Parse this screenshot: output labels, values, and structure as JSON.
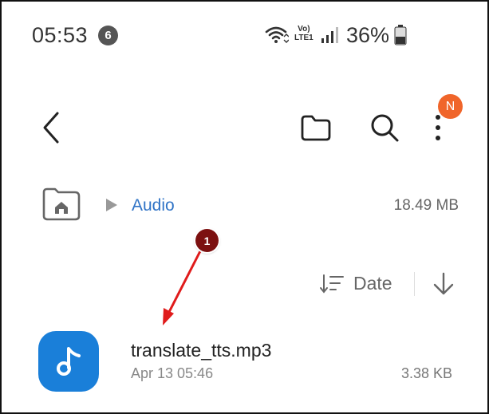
{
  "status_bar": {
    "time": "05:53",
    "notification_count": "6",
    "volte_line1": "Vo)",
    "volte_line2": "LTE1",
    "battery_percent": "36%"
  },
  "toolbar": {
    "back_icon": "chevron-left-icon",
    "folder_icon": "folder-icon",
    "search_icon": "search-icon",
    "more_icon": "more-vertical-icon",
    "avatar_initial": "N",
    "avatar_color": "#f0652a"
  },
  "breadcrumb": {
    "home_icon": "home-folder-icon",
    "current": "Audio",
    "storage_used": "18.49 MB"
  },
  "sort": {
    "label": "Date",
    "direction_icon": "arrow-down-icon"
  },
  "files": [
    {
      "name": "translate_tts.mp3",
      "date": "Apr 13 05:46",
      "size": "3.38 KB",
      "icon": "music-note-icon",
      "icon_color": "#1a7fd9"
    }
  ],
  "annotation": {
    "step_label": "1",
    "color": "#e01b1b"
  }
}
